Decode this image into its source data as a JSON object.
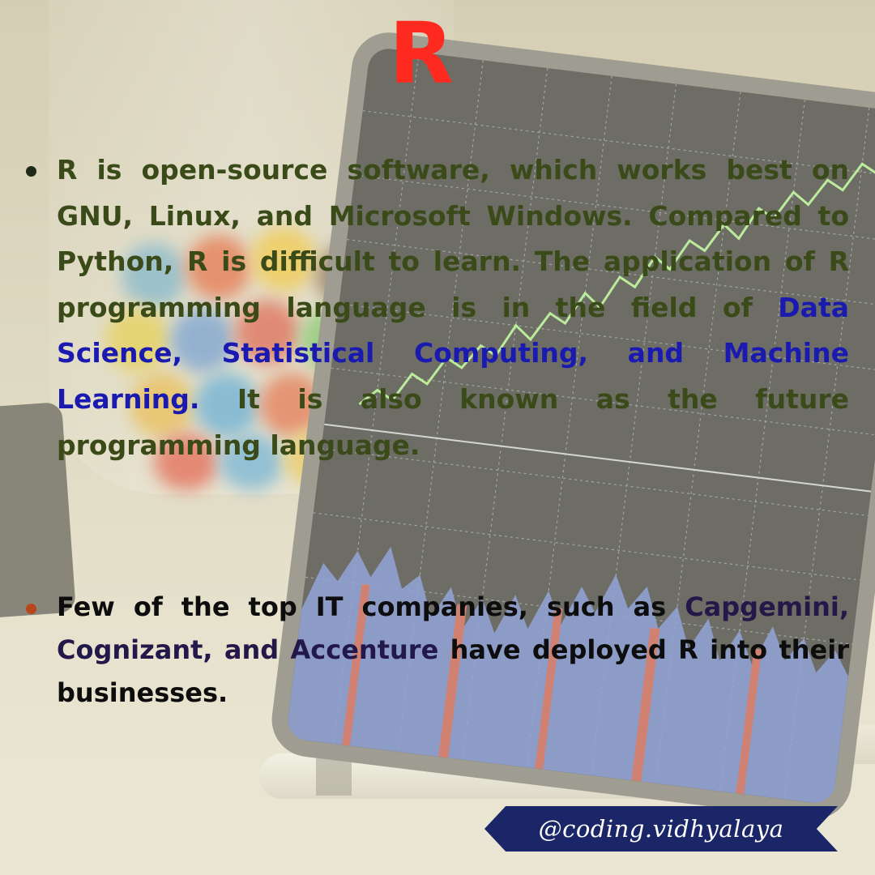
{
  "title": "R",
  "bullet1": {
    "lead": "R is open-source software, which works best on GNU, Linux, and Microsoft Windows. Compared to Python, R is difficult to learn. The application of R programming language is in the field of ",
    "highlight": "Data Science, Statistical Computing, and Machine Learning.",
    "tail": " It is also known as the future programming language."
  },
  "bullet2": {
    "lead": "Few of the top IT companies, such as ",
    "highlight": "Capgemini, Cognizant, and Accenture",
    "tail": " have deployed R into their businesses."
  },
  "handle": "@coding.vidhyalaya",
  "colors": {
    "title": "#ff2a1f",
    "body_text_1": "#3a4a18",
    "highlight_1": "#1a1ab0",
    "body_text_2": "#0d0d0d",
    "highlight_2": "#23184a",
    "handle_bg": "#1b2668"
  }
}
